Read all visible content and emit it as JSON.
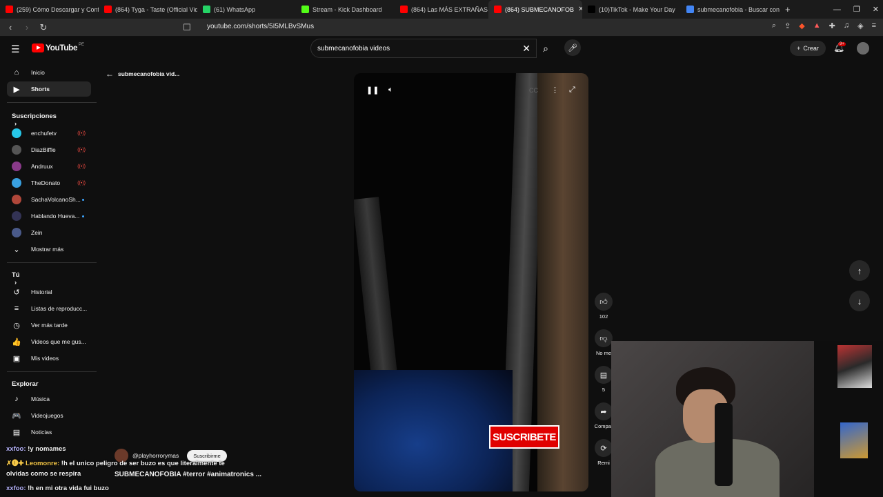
{
  "browser": {
    "tabs": [
      {
        "label": "(259) Cómo Descargar y Confi",
        "color": "#ff0000",
        "active": false
      },
      {
        "label": "(864) Tyga - Taste (Official Vide",
        "color": "#ff0000",
        "active": false
      },
      {
        "label": "(61) WhatsApp",
        "color": "#25d366",
        "active": false
      },
      {
        "label": "Stream - Kick Dashboard",
        "color": "#53fc18",
        "active": false
      },
      {
        "label": "(864) Las MÁS EXTRAÑAS CINT",
        "color": "#ff0000",
        "active": false
      },
      {
        "label": "(864) SUBMECANOFOB",
        "color": "#ff0000",
        "active": true
      },
      {
        "label": "(10)TikTok - Make Your Day",
        "color": "#000000",
        "active": false
      },
      {
        "label": "submecanofobia - Buscar con",
        "color": "#4285f4",
        "active": false
      }
    ],
    "new_tab": "+",
    "url": "youtube.com/shorts/5I5MLBvSMus"
  },
  "youtube": {
    "logo_text": "YouTube",
    "logo_country": "PE",
    "search_value": "submecanofobia videos",
    "create_label": "Crear",
    "notif_badge": "9+"
  },
  "sidebar": {
    "main": [
      {
        "label": "Inicio",
        "icon": "home-icon",
        "glyph": "⌂",
        "active": false
      },
      {
        "label": "Shorts",
        "icon": "shorts-icon",
        "glyph": "▶",
        "active": true
      }
    ],
    "subs_title": "Suscripciones",
    "subscriptions": [
      {
        "label": "enchufetv",
        "color": "#27c7e8",
        "status": "live"
      },
      {
        "label": "DiazBiffle",
        "color": "#555555",
        "status": "live"
      },
      {
        "label": "Andruux",
        "color": "#8a3a8a",
        "status": "live"
      },
      {
        "label": "TheDonato",
        "color": "#39a0e0",
        "status": "live"
      },
      {
        "label": "SachaVolcanoSh...",
        "color": "#b0473a",
        "status": "dot"
      },
      {
        "label": "Hablando Hueva...",
        "color": "#333355",
        "status": "dot"
      },
      {
        "label": "Zein",
        "color": "#4a5a8a",
        "status": "none"
      }
    ],
    "live_glyph": "((•))",
    "show_more": "Mostrar más",
    "you_title": "Tú",
    "you": [
      {
        "label": "Historial",
        "icon": "history-icon",
        "glyph": "↺"
      },
      {
        "label": "Listas de reproducc...",
        "icon": "playlist-icon",
        "glyph": "≡"
      },
      {
        "label": "Ver más tarde",
        "icon": "clock-icon",
        "glyph": "◷"
      },
      {
        "label": "Videos que me gus...",
        "icon": "thumb-up-icon",
        "glyph": "👍"
      },
      {
        "label": "Mis videos",
        "icon": "my-videos-icon",
        "glyph": "▣"
      }
    ],
    "explore_title": "Explorar",
    "explore": [
      {
        "label": "Música",
        "icon": "music-icon",
        "glyph": "♪"
      },
      {
        "label": "Videojuegos",
        "icon": "gamepad-icon",
        "glyph": "🎮"
      },
      {
        "label": "Noticias",
        "icon": "news-icon",
        "glyph": "▤"
      }
    ]
  },
  "short": {
    "back_label": "submecanofobia vid...",
    "sticker_text": "SUSCRIBETE",
    "channel": "@playhorrorymas",
    "subscribe_label": "Suscribirme",
    "caption": "SUBMECANOFOBIA #terror #animatronics ...",
    "likes": "102",
    "dislike_label": "No me",
    "comments": "5",
    "share_label": "Compar",
    "remix_label": "Remi"
  },
  "chat": [
    {
      "user": "xxfoo:",
      "text": "!y nomames",
      "style": "u1"
    },
    {
      "user": "✗🅘✚ Leomonre:",
      "text": "!h el unico peligro de ser buzo es que literalmente te",
      "style": "u2"
    },
    {
      "user": "",
      "text": "olvidas como se respira",
      "style": "none"
    },
    {
      "user": "xxfoo:",
      "text": "!h en mi otra vida fui buzo",
      "style": "u1"
    }
  ]
}
